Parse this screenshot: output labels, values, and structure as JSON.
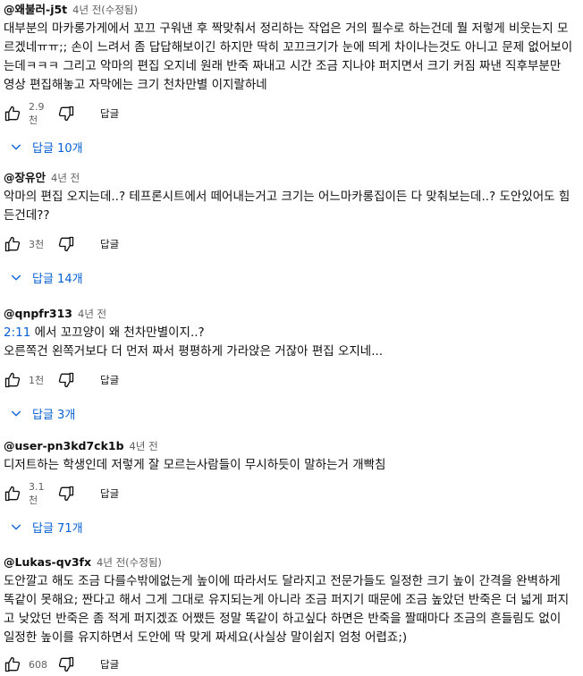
{
  "comments": [
    {
      "author": "@왜불러-j5t",
      "time": "4년 전(수정됨)",
      "body_lines": [
        "대부분의 마카롱가게에서 꼬끄 구워낸 후 짝맞춰서 정리하는 작업은 거의 필수로 하는건데 뭘 저렇게 비웃는지 모",
        "르겠네ㅠㅠ;; 손이 느려서 좀 답답해보이긴 하지만 딱히 꼬끄크기가 눈에 띄게 차이나는것도 아니고 문제 없어보이",
        "는데ㅋㅋㅋ 그리고 악마의 편집 오지네 원래 반죽 짜내고 시간 조금 지나야 퍼지면서 크기 커짐 짜낸 직후부분만",
        "영상 편집해놓고 자막에는 크기 천차만별 이지랄하네"
      ],
      "likes": "2.9천",
      "reply_label": "답글",
      "replies_label": "답글 10개"
    },
    {
      "author": "@장유안",
      "time": "4년 전",
      "body_lines": [
        "악마의 편집 오지는데..? 테프론시트에서 떼어내는거고 크기는 어느마카롱집이든 다 맞춰보는데..? 도안있어도 힘",
        "든건데??"
      ],
      "likes": "3천",
      "reply_label": "답글",
      "replies_label": "답글 14개"
    },
    {
      "author": "@qnpfr313",
      "time": "4년 전",
      "timestamp_link": "2:11",
      "body_first_rest": " 에서 꼬끄양이 왜 천차만별이지..?",
      "body_lines": [
        "오른쪽건 왼쪽거보다 더 먼저 짜서 평평하게 가라앉은 거잖아 편집 오지네..."
      ],
      "likes": "1천",
      "reply_label": "답글",
      "replies_label": "답글 3개"
    },
    {
      "author": "@user-pn3kd7ck1b",
      "time": "4년 전",
      "body_lines": [
        "디저트하는 학생인데 저렇게 잘 모르는사람들이 무시하듯이 말하는거 개빡침"
      ],
      "likes": "3.1천",
      "reply_label": "답글",
      "replies_label": "답글 71개"
    },
    {
      "author": "@Lukas-qv3fx",
      "time": "4년 전(수정됨)",
      "body_lines": [
        "도안깔고 해도 조금 다를수밖에없는게 높이에 따라서도 달라지고 전문가들도 일정한 크기 높이 간격을 완벽하게",
        "똑같이 못해요; 짠다고 해서 그게 그대로 유지되는게 아니라 조금 퍼지기 때문에 조금 높았던 반죽은 더 넓게 퍼지",
        "고 낮았던 반죽은 좀 적게 퍼지겠죠 어쨌든 정말 똑같이 하고싶다 하면은 반죽을 짤때마다 조금의 흔들림도 없이",
        "일정한 높이를 유지하면서 도안에 딱 맞게 짜세요(사실상 말이쉽지 엄청 어렵죠;)"
      ],
      "likes": "608",
      "reply_label": "답글"
    }
  ],
  "icons": {
    "like": "thumbs-up-icon",
    "dislike": "thumbs-down-icon",
    "expand": "chevron-down-icon"
  },
  "colors": {
    "link": "#065fd4",
    "meta": "#606060"
  }
}
